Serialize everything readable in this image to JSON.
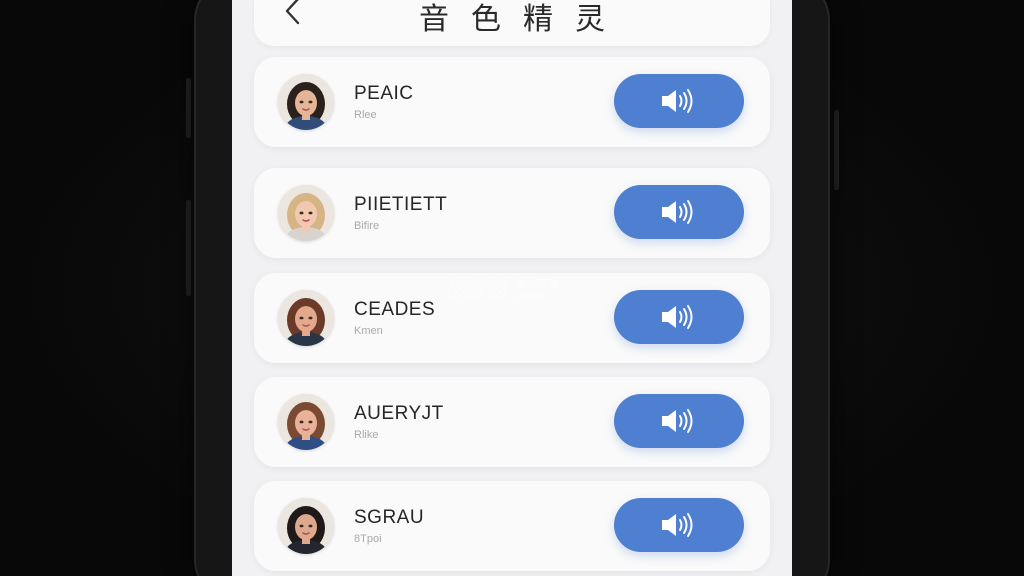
{
  "header": {
    "title": "音色精灵",
    "back_icon": "chevron-left-icon"
  },
  "voices": [
    {
      "name": "PEAIC",
      "subtitle": "Rlee",
      "avatar_hair": "#2b211c",
      "avatar_skin": "#e4b597",
      "avatar_shirt": "#2f4d78"
    },
    {
      "name": "PIIETIETT",
      "subtitle": "Bifire",
      "avatar_hair": "#d7b483",
      "avatar_skin": "#f1c9b0",
      "avatar_shirt": "#d9d3cf"
    },
    {
      "name": "CEADES",
      "subtitle": "Kmen",
      "avatar_hair": "#6b3a28",
      "avatar_skin": "#e2a98c",
      "avatar_shirt": "#2b3548"
    },
    {
      "name": "AUERYJT",
      "subtitle": "Rlike",
      "avatar_hair": "#7a4a32",
      "avatar_skin": "#e7b298",
      "avatar_shirt": "#2f4e86"
    },
    {
      "name": "SGRAU",
      "subtitle": "8Tpoi",
      "avatar_hair": "#1f1a18",
      "avatar_skin": "#dca88e",
      "avatar_shirt": "#23262e"
    }
  ],
  "play_icon": "speaker-volume-icon",
  "accent_color": "#4f7fd0",
  "watermark": {
    "logo": "K73",
    "site_cn": "游戏之家",
    "domain": ".com"
  }
}
